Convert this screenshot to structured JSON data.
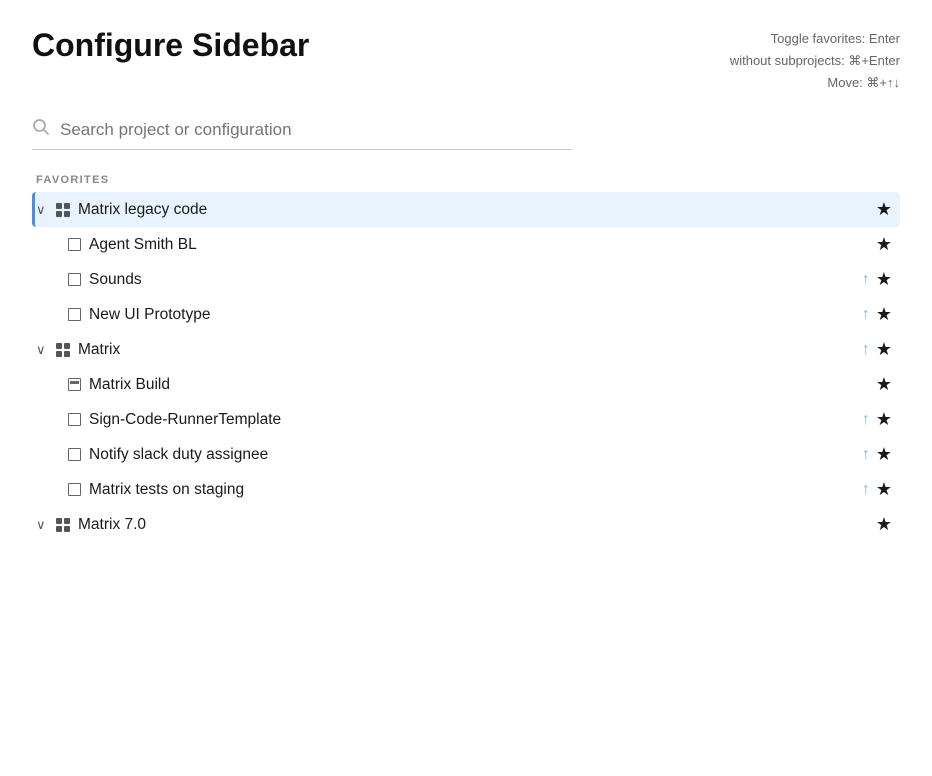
{
  "header": {
    "title": "Configure Sidebar",
    "shortcuts": {
      "line1": "Toggle favorites: Enter",
      "line2": "without subprojects: ⌘+Enter",
      "line3": "Move: ⌘+↑↓"
    }
  },
  "search": {
    "placeholder": "Search project or configuration"
  },
  "sections": [
    {
      "label": "FAVORITES",
      "items": [
        {
          "type": "parent",
          "active": true,
          "expanded": true,
          "icon": "grid",
          "label": "Matrix legacy code",
          "hasUpArrow": false,
          "starred": true
        },
        {
          "type": "child",
          "icon": "square",
          "label": "Agent Smith BL",
          "hasUpArrow": false,
          "starred": true
        },
        {
          "type": "child",
          "icon": "square",
          "label": "Sounds",
          "hasUpArrow": true,
          "starred": true
        },
        {
          "type": "child",
          "icon": "square",
          "label": "New UI Prototype",
          "hasUpArrow": true,
          "starred": true
        },
        {
          "type": "parent",
          "active": false,
          "expanded": true,
          "icon": "grid",
          "label": "Matrix",
          "hasUpArrow": true,
          "starred": true
        },
        {
          "type": "child",
          "icon": "build",
          "label": "Matrix Build",
          "hasUpArrow": false,
          "starred": true
        },
        {
          "type": "child",
          "icon": "square",
          "label": "Sign-Code-RunnerTemplate",
          "hasUpArrow": true,
          "starred": true
        },
        {
          "type": "child",
          "icon": "square",
          "label": "Notify slack duty assignee",
          "hasUpArrow": true,
          "starred": true
        },
        {
          "type": "child",
          "icon": "square",
          "label": "Matrix tests on staging",
          "hasUpArrow": true,
          "starred": true
        },
        {
          "type": "parent",
          "active": false,
          "expanded": true,
          "icon": "grid",
          "label": "Matrix 7.0",
          "hasUpArrow": false,
          "starred": true
        }
      ]
    }
  ]
}
